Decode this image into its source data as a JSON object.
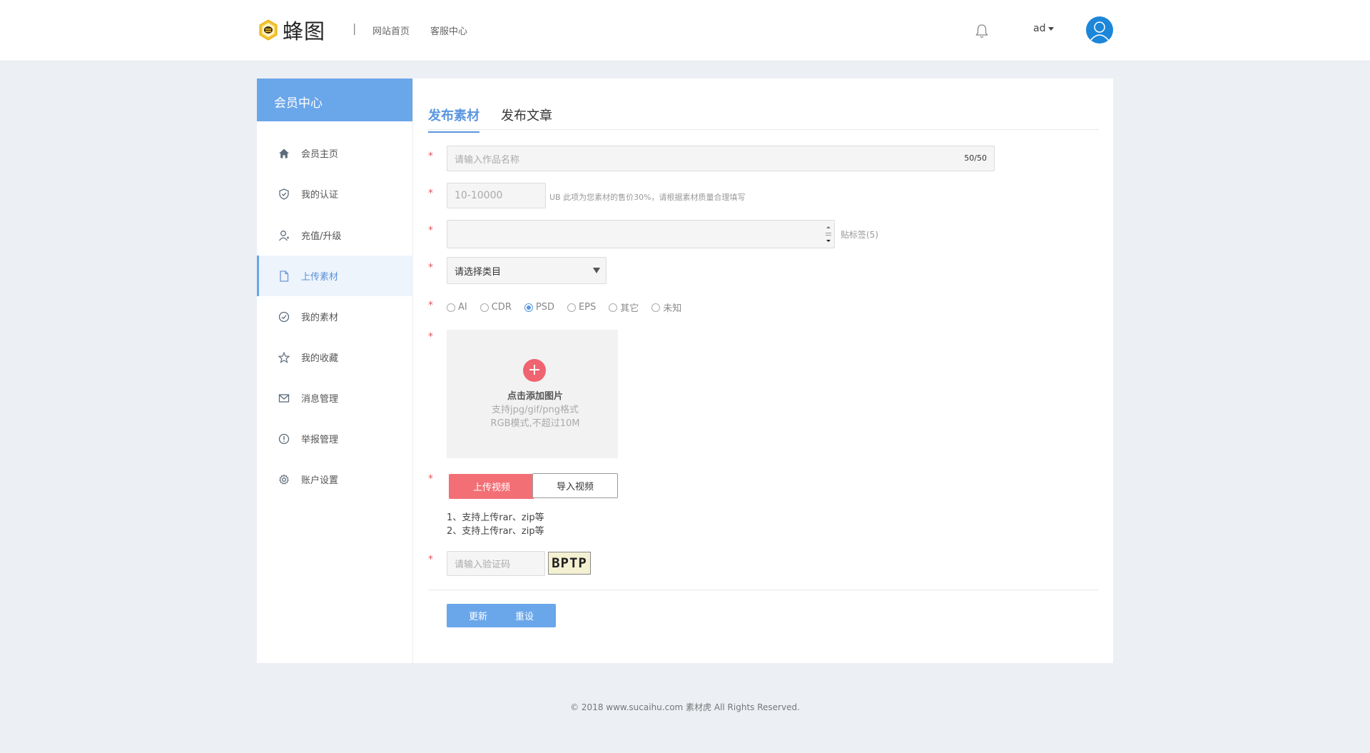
{
  "header": {
    "logo_text": "蜂图",
    "separator": "|",
    "links": [
      "网站首页",
      "客服中心"
    ],
    "user_name": "ad"
  },
  "sidebar": {
    "title": "会员中心",
    "items": [
      {
        "label": "会员主页",
        "icon": "home-icon"
      },
      {
        "label": "我的认证",
        "icon": "shield-icon"
      },
      {
        "label": "充值/升级",
        "icon": "user-icon"
      },
      {
        "label": "上传素材",
        "icon": "file-icon",
        "active": true
      },
      {
        "label": "我的素材",
        "icon": "check-circle-icon"
      },
      {
        "label": "我的收藏",
        "icon": "star-icon"
      },
      {
        "label": "消息管理",
        "icon": "mail-icon"
      },
      {
        "label": "举报管理",
        "icon": "alert-icon"
      },
      {
        "label": "账户设置",
        "icon": "gear-icon"
      }
    ]
  },
  "tabs": [
    "发布素材",
    "发布文章"
  ],
  "form": {
    "required_mark": "*",
    "title_placeholder": "请输入作品名称",
    "title_counter": "50/50",
    "price_placeholder": "10-10000",
    "price_hint": "UB 此项为您素材的售价30%，请根据素材质量合理填写",
    "tags_hint": "贴标签(5)",
    "category_placeholder": "请选择类目",
    "formats": [
      "AI",
      "CDR",
      "PSD",
      "EPS",
      "其它",
      "未知"
    ],
    "format_selected": "PSD",
    "upload": {
      "plus": "+",
      "title": "点击添加图片",
      "line1": "支持jpg/gif/png格式",
      "line2": "RGB模式,不超过10M"
    },
    "upload_video_label": "上传视频",
    "import_video_label": "导入视频",
    "notes": [
      "1、支持上传rar、zip等",
      "2、支持上传rar、zip等"
    ],
    "captcha_placeholder": "请输入验证码",
    "captcha_text": "BPTP",
    "update_label": "更新",
    "reset_label": "重设"
  },
  "footer": {
    "copyright": "© 2018 www.sucaihu.com 素材虎 All Rights Reserved."
  },
  "colors": {
    "accent": "#6aa6ea",
    "danger": "#f26f76",
    "avatar": "#1c86d8"
  }
}
